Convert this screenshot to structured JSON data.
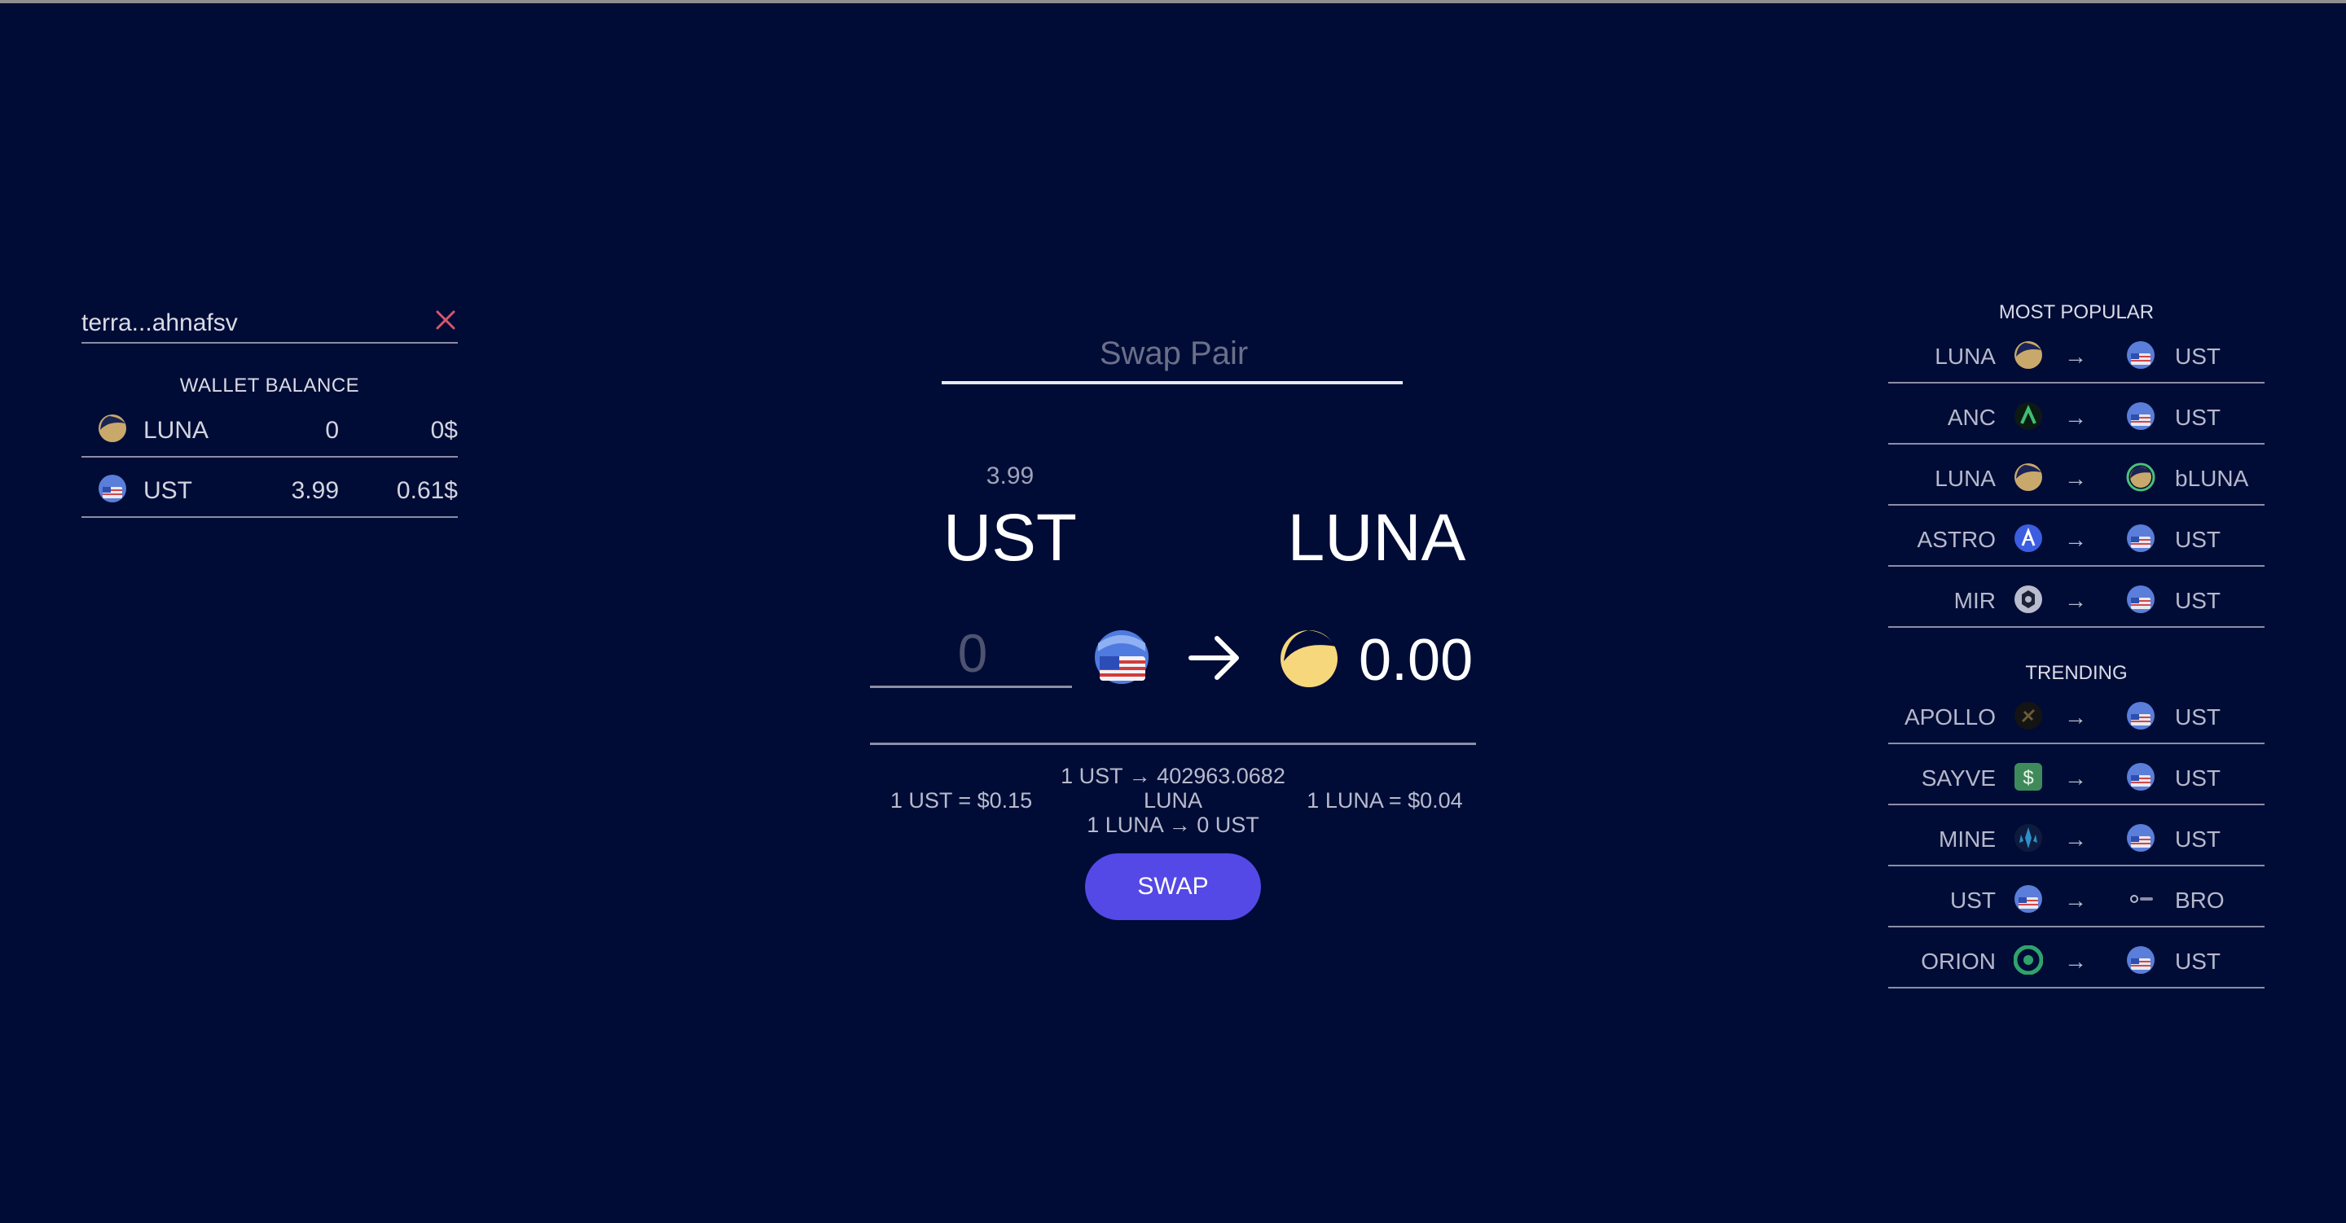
{
  "wallet": {
    "address": "terra...ahnafsv",
    "title": "WALLET BALANCE",
    "balances": [
      {
        "symbol": "LUNA",
        "amount": "0",
        "usd": "0$",
        "icon": "luna-icon"
      },
      {
        "symbol": "UST",
        "amount": "3.99",
        "usd": "0.61$",
        "icon": "ust-flag-icon"
      }
    ]
  },
  "swap": {
    "search_placeholder": "Swap Pair",
    "from_balance": "3.99",
    "from_symbol": "UST",
    "to_symbol": "LUNA",
    "amount_placeholder": "0",
    "amount_out": "0.00",
    "from_price": "1 UST = $0.15",
    "rate_line1": "1 UST → 402963.0682",
    "rate_line2": "LUNA",
    "rate_line3": "1 LUNA → 0 UST",
    "to_price": "1 LUNA = $0.04",
    "button": "SWAP"
  },
  "pairs": {
    "popular_title": "MOST POPULAR",
    "popular": [
      {
        "from": "LUNA",
        "from_icon": "luna-icon",
        "to": "UST",
        "to_icon": "ust-flag-icon"
      },
      {
        "from": "ANC",
        "from_icon": "anc-icon",
        "to": "UST",
        "to_icon": "ust-flag-icon"
      },
      {
        "from": "LUNA",
        "from_icon": "luna-icon",
        "to": "bLUNA",
        "to_icon": "bluna-icon"
      },
      {
        "from": "ASTRO",
        "from_icon": "astro-icon",
        "to": "UST",
        "to_icon": "ust-flag-icon"
      },
      {
        "from": "MIR",
        "from_icon": "mir-icon",
        "to": "UST",
        "to_icon": "ust-flag-icon"
      }
    ],
    "trending_title": "TRENDING",
    "trending": [
      {
        "from": "APOLLO",
        "from_icon": "apollo-icon",
        "to": "UST",
        "to_icon": "ust-flag-icon"
      },
      {
        "from": "SAYVE",
        "from_icon": "sayve-icon",
        "to": "UST",
        "to_icon": "ust-flag-icon"
      },
      {
        "from": "MINE",
        "from_icon": "mine-icon",
        "to": "UST",
        "to_icon": "ust-flag-icon"
      },
      {
        "from": "UST",
        "from_icon": "ust-flag-icon",
        "to": "BRO",
        "to_icon": "bro-icon"
      },
      {
        "from": "ORION",
        "from_icon": "orion-icon",
        "to": "UST",
        "to_icon": "ust-flag-icon"
      }
    ],
    "arrow": "→"
  },
  "colors": {
    "background": "#000c36",
    "accent": "#5448e6",
    "close": "#d9566a",
    "luna_yellow": "#f7d77b"
  }
}
